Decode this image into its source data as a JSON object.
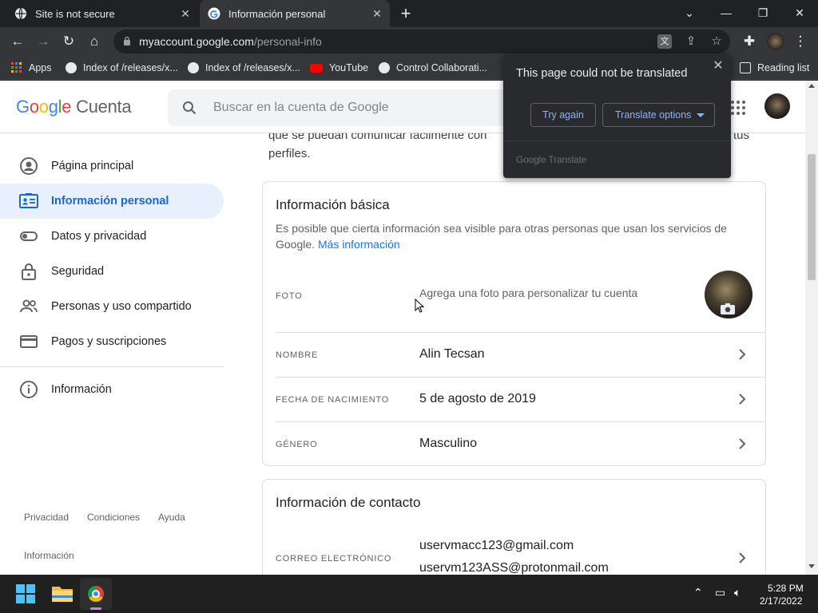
{
  "browser": {
    "tabs": [
      {
        "title": "Site is not secure",
        "active": false
      },
      {
        "title": "Información personal",
        "active": true
      }
    ],
    "url_host": "myaccount.google.com",
    "url_path": "/personal-info",
    "bookmarks": [
      "Apps",
      "Index of /releases/x...",
      "Index of /releases/x...",
      "YouTube",
      "Control Collaborati...",
      "Reading list"
    ]
  },
  "header": {
    "logo_google": [
      "G",
      "o",
      "o",
      "g",
      "l",
      "e"
    ],
    "logo_suffix": "Cuenta",
    "search_placeholder": "Buscar en la cuenta de Google"
  },
  "sidebar": {
    "items": [
      {
        "label": "Página principal",
        "active": false
      },
      {
        "label": "Información personal",
        "active": true
      },
      {
        "label": "Datos y privacidad",
        "active": false
      },
      {
        "label": "Seguridad",
        "active": false
      },
      {
        "label": "Personas y uso compartido",
        "active": false
      },
      {
        "label": "Pagos y suscripciones",
        "active": false
      },
      {
        "label": "Información",
        "active": false
      }
    ],
    "footer_links": [
      "Privacidad",
      "Condiciones",
      "Ayuda",
      "Información"
    ]
  },
  "main": {
    "intro_partial": "que se puedan comunicar fácilmente con … tus perfiles.",
    "intro_line1": "que se puedan comunicar fácilmente con",
    "intro_line1_tail": "tus",
    "intro_line2": "perfiles.",
    "basic_card": {
      "title": "Información básica",
      "desc": "Es posible que cierta información sea visible para otras personas que usan los servicios de Google.",
      "link": "Más información",
      "foto_label": "FOTO",
      "foto_hint": "Agrega una foto para personalizar tu cuenta",
      "rows": [
        {
          "label": "NOMBRE",
          "value": "Alin Tecsan"
        },
        {
          "label": "FECHA DE NACIMIENTO",
          "value": "5 de agosto de 2019"
        },
        {
          "label": "GÉNERO",
          "value": "Masculino"
        }
      ]
    },
    "contact_card": {
      "title": "Información de contacto",
      "email_label": "CORREO ELECTRÓNICO",
      "emails": [
        "uservmacc123@gmail.com",
        "uservm123ASS@protonmail.com"
      ]
    }
  },
  "translate_popup": {
    "title": "This page could not be translated",
    "try_again": "Try again",
    "options": "Translate options",
    "brand": "Google Translate"
  },
  "taskbar": {
    "time": "5:28 PM",
    "date": "2/17/2022"
  },
  "colors": {
    "accent": "#1a73e8",
    "active_nav_bg": "#e8f0fe",
    "chrome_dark": "#202124"
  }
}
